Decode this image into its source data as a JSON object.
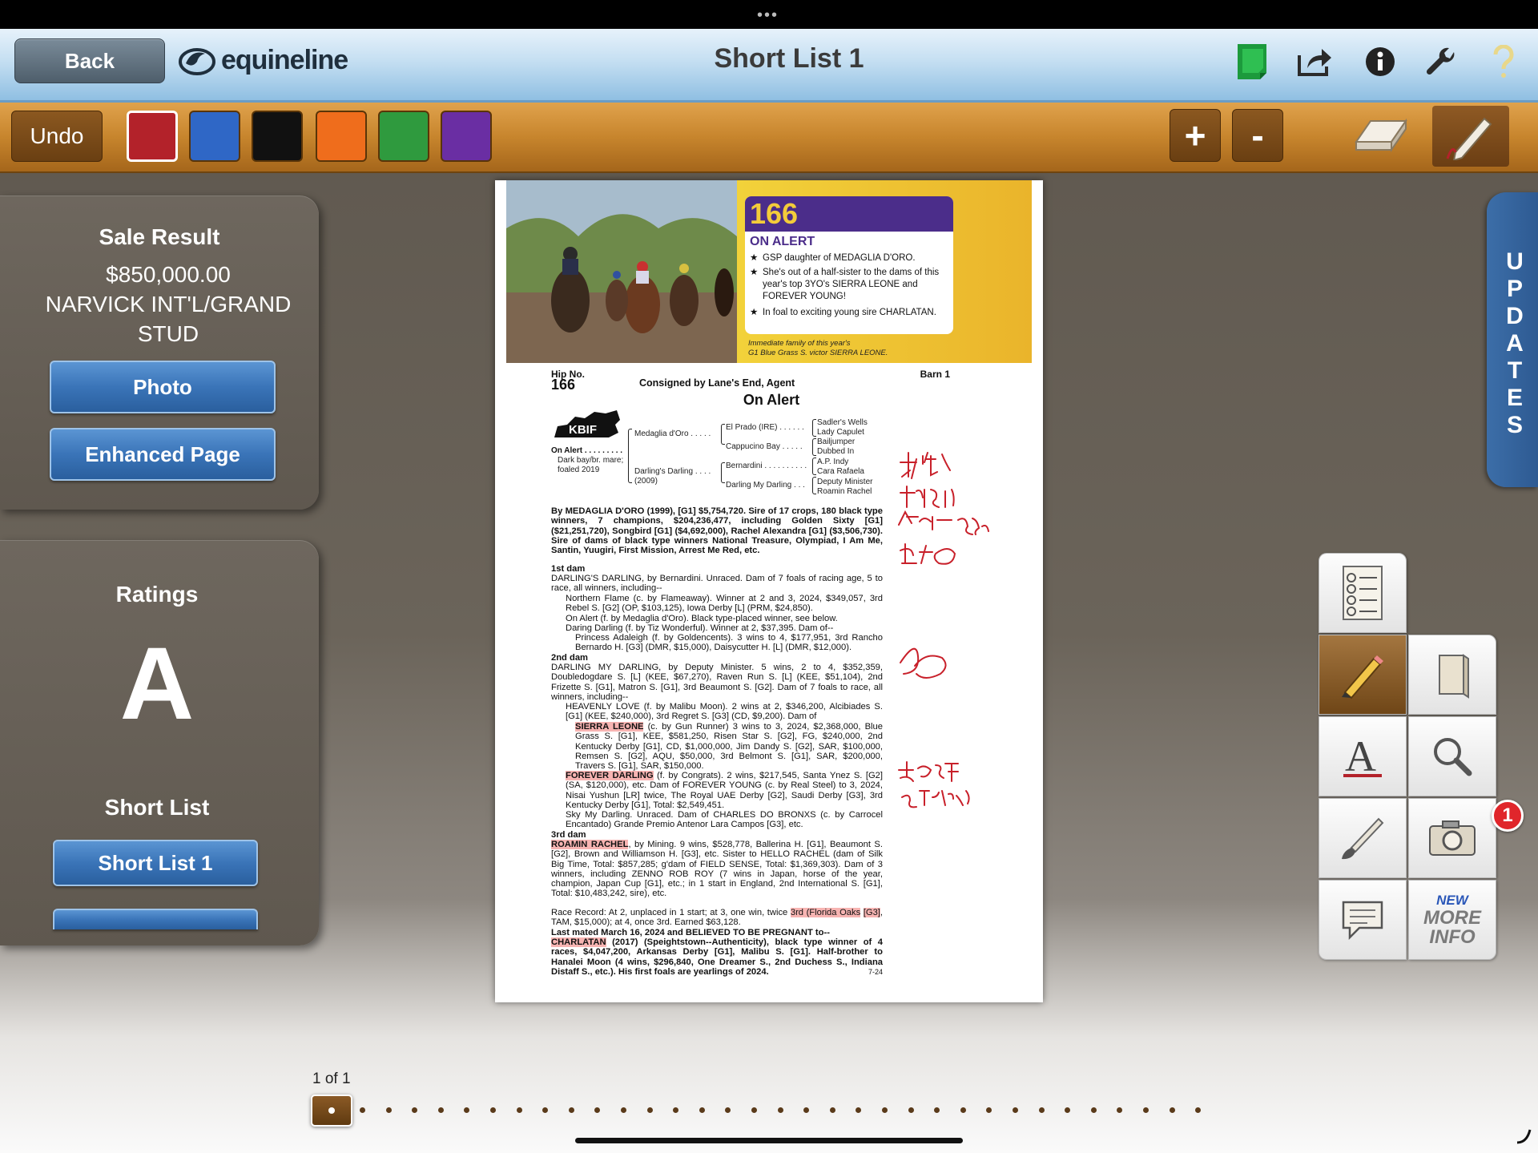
{
  "header": {
    "back_label": "Back",
    "logo_text": "equineline",
    "title": "Short List 1",
    "icons": [
      "notes-icon",
      "share-icon",
      "info-icon",
      "wrench-icon",
      "help-icon"
    ]
  },
  "toolbar": {
    "undo_label": "Undo",
    "colors": [
      "#b3222a",
      "#2f67c6",
      "#111111",
      "#ef6d1c",
      "#2f9a3e",
      "#6a2ea3"
    ],
    "selected_color": "#b3222a",
    "plus_label": "+",
    "minus_label": "-"
  },
  "sale": {
    "heading": "Sale Result",
    "price": "$850,000.00",
    "buyer_line1": "NARVICK INT'L/GRAND",
    "buyer_line2": "STUD",
    "photo_button": "Photo",
    "enhanced_button": "Enhanced Page"
  },
  "ratings": {
    "heading": "Ratings",
    "grade": "A",
    "shortlist_heading": "Short List",
    "shortlist_button": "Short List 1"
  },
  "document": {
    "promo": {
      "hip": "166",
      "name": "ON ALERT",
      "bullets": [
        "GSP daughter of MEDAGLIA D'ORO.",
        "She's out of a half-sister to the dams of this year's top 3YO's SIERRA LEONE and FOREVER YOUNG!",
        "In foal to exciting young sire CHARLATAN."
      ],
      "caption_line1": "Immediate family of this year's",
      "caption_line2": "G1 Blue Grass S. victor SIERRA LEONE."
    },
    "hip_label": "Hip No.",
    "hip_number": "166",
    "consignor": "Consigned by Lane's End, Agent",
    "barn": "Barn 1",
    "horse_name": "On Alert",
    "kbif": "KBIF",
    "pedigree": {
      "subject": "On Alert . . . . . . . . .",
      "subject_desc1": "Dark bay/br. mare;",
      "subject_desc2": "foaled 2019",
      "sire": "Medaglia d'Oro . . . . .",
      "dam": "Darling's Darling . . . .",
      "dam_year": "(2009)",
      "ss": "El Prado (IRE) . . . . . .",
      "sd": "Cappucino Bay . . . . .",
      "ds": "Bernardini . . . . . . . . . .",
      "dd": "Darling My Darling . . .",
      "g": [
        "Sadler's Wells",
        "Lady Capulet",
        "Bailjumper",
        "Dubbed In",
        "A.P. Indy",
        "Cara Rafaela",
        "Deputy Minister",
        "Roamin Rachel"
      ]
    },
    "sire_para": "By MEDAGLIA D'ORO (1999), [G1] $5,754,720. Sire of 17 crops, 180 black type winners, 7 champions, $204,236,477, including Golden Sixty [G1] ($21,251,720), Songbird [G1] ($4,692,000), Rachel Alexandra [G1] ($3,506,730). Sire of dams of black type winners National Treasure, Olympiad, I Am Me, Santin, Yuugiri, First Mission, Arrest Me Red, etc.",
    "dam1_head": "1st dam",
    "dam1_text": "DARLING'S DARLING, by Bernardini. Unraced. Dam of 7 foals of racing age, 5 to race, all winners, including--",
    "dam1_items": [
      "Northern Flame (c. by Flameaway). Winner at 2 and 3, 2024, $349,057, 3rd Rebel S. [G2] (OP, $103,125), Iowa Derby [L] (PRM, $24,850).",
      "On Alert (f. by Medaglia d'Oro). Black type-placed winner, see below.",
      "Daring Darling (f. by Tiz Wonderful). Winner at 2, $37,395. Dam of--",
      "Princess Adaleigh (f. by Goldencents). 3 wins to 4, $177,951, 3rd Rancho Bernardo H. [G3] (DMR, $15,000), Daisycutter H. [L] (DMR, $12,000)."
    ],
    "dam2_head": "2nd dam",
    "dam2_text": "DARLING MY DARLING, by Deputy Minister. 5 wins, 2 to 4, $352,359, Doubledogdare S. [L] (KEE, $67,270), Raven Run S. [L] (KEE, $51,104), 2nd Frizette S. [G1], Matron S. [G1], 3rd Beaumont S. [G2]. Dam of 7 foals to race, all winners, including--",
    "dam2_heavenly": "HEAVENLY LOVE (f. by Malibu Moon). 2 wins at 2, $346,200, Alcibiades S. [G1] (KEE, $240,000), 3rd Regret S. [G3] (CD, $9,200). Dam of",
    "dam2_sierra_name": "SIERRA LEONE",
    "dam2_sierra": " (c. by Gun Runner) 3 wins to 3, 2024, $2,368,000, Blue Grass S. [G1], KEE, $581,250, Risen Star S. [G2], FG, $240,000, 2nd Kentucky Derby [G1], CD, $1,000,000, Jim Dandy S. [G2], SAR, $100,000, Remsen S. [G2], AQU, $50,000, 3rd Belmont S. [G1], SAR, $200,000, Travers S. [G1], SAR, $150,000.",
    "dam2_forever_name": "FOREVER DARLING",
    "dam2_forever": " (f. by Congrats). 2 wins, $217,545, Santa Ynez S. [G2] (SA, $120,000), etc. Dam of FOREVER YOUNG (c. by Real Steel) to 3, 2024, Nisai Yushun [LR] twice, The Royal UAE Derby [G2], Saudi Derby [G3], 3rd Kentucky Derby [G1], Total: $2,549,451.",
    "dam2_sky": "Sky My Darling. Unraced. Dam of CHARLES DO BRONXS (c. by Carrocel Encantado) Grande Premio Antenor Lara Campos [G3], etc.",
    "dam3_head": "3rd dam",
    "dam3_name": "ROAMIN RACHEL",
    "dam3_text": ", by Mining. 9 wins, $528,778, Ballerina H. [G1], Beaumont S. [G2], Brown and Williamson H. [G3], etc. Sister to HELLO RACHEL (dam of Silk Big Time, Total: $857,285; g'dam of FIELD SENSE, Total: $1,369,303). Dam of 3 winners, including ZENNO ROB ROY (7 wins in Japan, horse of the year, champion, Japan Cup [G1], etc.; in 1 start in England, 2nd International S. [G1], Total: $10,483,242, sire), etc.",
    "race_record_a": "Race Record: At 2, unplaced in 1 start; at 3, one win, twice ",
    "race_record_hl1": "3rd (Florida Oaks",
    "race_record_hl2": "[G3]",
    "race_record_b": ", TAM, $15,000); at 4, once 3rd. Earned $63,128.",
    "last_mated": "Last mated March 16, 2024 and BELIEVED TO BE PREGNANT to--",
    "charlatan_name": "CHARLATAN",
    "charlatan_text": " (2017) (Speightstown--Authenticity), black type winner of 4 races, $4,047,200, Arkansas Derby [G1], Malibu S. [G1]. Half-brother to Hanalei Moon (4 wins, $296,840, One Dreamer S., 2nd Duchess S., Indiana Distaff S., etc.). His first foals are yearlings of 2024.",
    "page_code": "7-24"
  },
  "palette": [
    "checklist-icon",
    "pencil-icon",
    "notebook-icon",
    "text-icon",
    "search-icon",
    "brush-icon",
    "camera-icon",
    "comment-icon",
    "more-info-icon"
  ],
  "more_info": {
    "new": "NEW",
    "line1": "MORE",
    "line2": "INFO"
  },
  "camera_badge": "1",
  "updates_label": "UPDATES",
  "pager": {
    "label": "1 of 1",
    "dots": 33
  }
}
